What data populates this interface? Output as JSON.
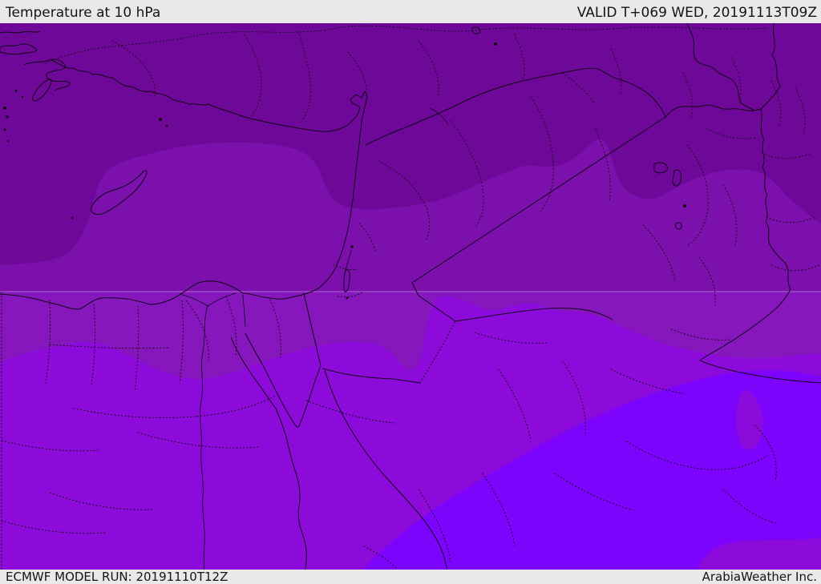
{
  "header": {
    "title": "Temperature at 10 hPa",
    "valid_label": "VALID T+069 WED, 20191113T09Z"
  },
  "footer": {
    "model_run_label": "ECMWF MODEL RUN: 20191110T12Z",
    "credit_label": "ArabiaWeather Inc."
  },
  "map": {
    "description": "Filled-contour temperature forecast map at 10 hPa over the Middle East and Eastern Mediterranean",
    "bar_background": "#e9e9e9",
    "gridline_color": "rgba(255,255,255,0.35)",
    "outline_color": "#120617",
    "bands": [
      {
        "name": "band-coldest-top",
        "color": "#6e0899"
      },
      {
        "name": "band-cold",
        "color": "#7c10ad"
      },
      {
        "name": "band-mild-strip",
        "color": "#8517bd"
      },
      {
        "name": "band-warm-south",
        "color": "#8c0bdb"
      },
      {
        "name": "band-warmest-southeast",
        "color": "#7c04fd"
      }
    ]
  }
}
